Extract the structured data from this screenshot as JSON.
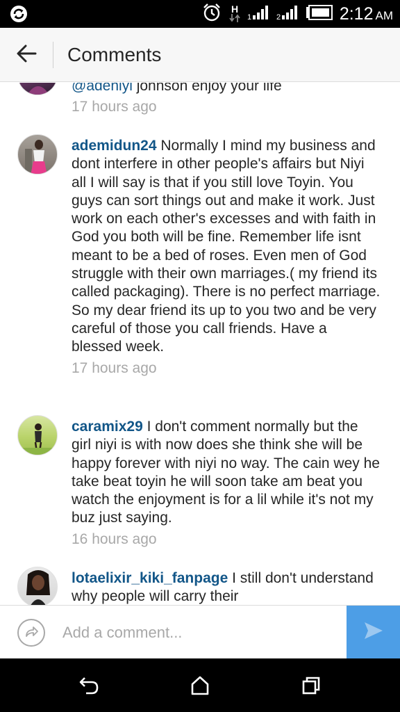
{
  "status_bar": {
    "time": "2:12",
    "ampm": "AM",
    "network_label": "H",
    "icons": [
      "sync-icon",
      "alarm-icon",
      "network-h-icon",
      "signal-1-icon",
      "signal-2-icon",
      "battery-icon"
    ]
  },
  "header": {
    "title": "Comments",
    "back_icon": "arrow-left-icon"
  },
  "comments": [
    {
      "mention": "@adeniyi",
      "text": " johnson enjoy your life",
      "time": "17 hours ago"
    },
    {
      "username": "ademidun24",
      "text": " Normally I mind my business and dont interfere in other people's affairs but Niyi all I will say is that if you still love Toyin. You guys can sort things out and make it work. Just work on each other's excesses and with faith in God you both will be fine. Remember life isnt meant to be a bed of roses. Even men of God struggle with their own marriages.( my friend its called packaging). There is no perfect marriage. So my dear friend its up to you two and be very careful of those you call friends. Have a blessed week.",
      "time": "17 hours ago"
    },
    {
      "username": "caramix29",
      "text": " I don't comment normally but the girl niyi is with now does she think she will be happy forever with niyi no way. The cain wey he take beat toyin he will soon take am beat you watch the enjoyment is for a lil while it's not my buz just saying.",
      "time": "16 hours ago"
    },
    {
      "username": "lotaelixir_kiki_fanpage",
      "text": " I still don't understand why people will carry their"
    }
  ],
  "composer": {
    "placeholder": "Add a comment...",
    "mention_icon": "mention-circle-icon",
    "send_icon": "send-arrow-icon"
  },
  "nav_bar": {
    "icons": [
      "back-nav-icon",
      "home-nav-icon",
      "recents-nav-icon"
    ]
  },
  "colors": {
    "username": "#125688",
    "timestamp": "#a8a8a8",
    "send_button": "#4d9ee6",
    "header_bg": "#f7f7f7"
  }
}
